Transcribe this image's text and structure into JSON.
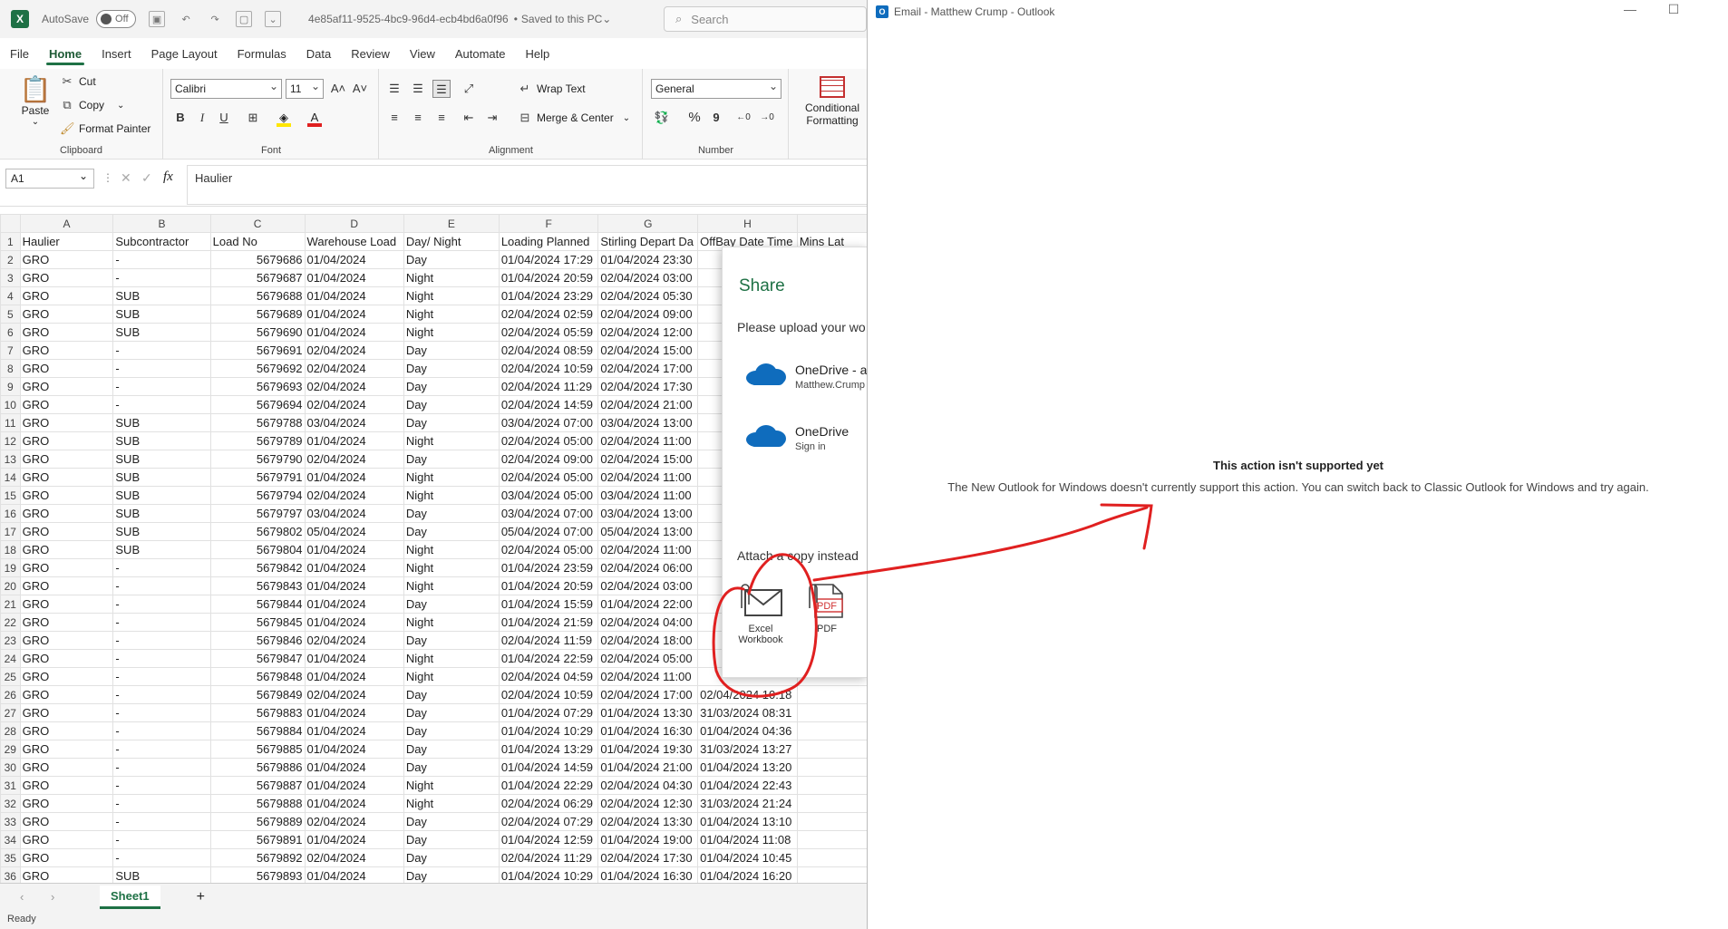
{
  "excel": {
    "title": {
      "autosave_label": "AutoSave",
      "autosave_state": "Off",
      "doc_name": "4e85af11-9525-4bc9-96d4-ecb4bd6a0f96",
      "doc_status": "Saved to this PC",
      "search_placeholder": "Search",
      "logo": "X"
    },
    "menu": [
      "File",
      "Home",
      "Insert",
      "Page Layout",
      "Formulas",
      "Data",
      "Review",
      "View",
      "Automate",
      "Help"
    ],
    "ribbon": {
      "clipboard": {
        "paste": "Paste",
        "cut": "Cut",
        "copy": "Copy",
        "format_painter": "Format Painter",
        "label": "Clipboard"
      },
      "font": {
        "name": "Calibri",
        "size": "11",
        "label": "Font",
        "bold": "B",
        "italic": "I",
        "underline": "U",
        "grow": "A˄",
        "shrink": "A˅"
      },
      "alignment": {
        "wrap": "Wrap Text",
        "merge": "Merge & Center",
        "label": "Alignment"
      },
      "number": {
        "format": "General",
        "label": "Number",
        "percent": "%",
        "comma": "9"
      },
      "styles": {
        "cond1": "Conditional",
        "cond2": "Formatting"
      }
    },
    "formula": {
      "namebox": "A1",
      "fx": "fx",
      "value": "Haulier"
    },
    "columns": [
      "A",
      "B",
      "C",
      "D",
      "E",
      "F",
      "G",
      "H",
      ""
    ],
    "headers": [
      "Haulier",
      "Subcontractor",
      "Load No",
      "Warehouse Load",
      "Day/ Night",
      "Loading Planned",
      "Stirling Depart Da",
      "OffBay Date Time",
      "Mins Lat"
    ],
    "rows": [
      [
        "GRO",
        "-",
        "5679686",
        "01/04/2024",
        "Day",
        "01/04/2024 17:29",
        "01/04/2024 23:30",
        "",
        ""
      ],
      [
        "GRO",
        "-",
        "5679687",
        "01/04/2024",
        "Night",
        "01/04/2024 20:59",
        "02/04/2024 03:00",
        "",
        ""
      ],
      [
        "GRO",
        "SUB",
        "5679688",
        "01/04/2024",
        "Night",
        "01/04/2024 23:29",
        "02/04/2024 05:30",
        "",
        ""
      ],
      [
        "GRO",
        "SUB",
        "5679689",
        "01/04/2024",
        "Night",
        "02/04/2024 02:59",
        "02/04/2024 09:00",
        "",
        ""
      ],
      [
        "GRO",
        "SUB",
        "5679690",
        "01/04/2024",
        "Night",
        "02/04/2024 05:59",
        "02/04/2024 12:00",
        "",
        ""
      ],
      [
        "GRO",
        "-",
        "5679691",
        "02/04/2024",
        "Day",
        "02/04/2024 08:59",
        "02/04/2024 15:00",
        "",
        ""
      ],
      [
        "GRO",
        "-",
        "5679692",
        "02/04/2024",
        "Day",
        "02/04/2024 10:59",
        "02/04/2024 17:00",
        "",
        ""
      ],
      [
        "GRO",
        "-",
        "5679693",
        "02/04/2024",
        "Day",
        "02/04/2024 11:29",
        "02/04/2024 17:30",
        "",
        ""
      ],
      [
        "GRO",
        "-",
        "5679694",
        "02/04/2024",
        "Day",
        "02/04/2024 14:59",
        "02/04/2024 21:00",
        "",
        ""
      ],
      [
        "GRO",
        "SUB",
        "5679788",
        "03/04/2024",
        "Day",
        "03/04/2024 07:00",
        "03/04/2024 13:00",
        "",
        ""
      ],
      [
        "GRO",
        "SUB",
        "5679789",
        "01/04/2024",
        "Night",
        "02/04/2024 05:00",
        "02/04/2024 11:00",
        "",
        ""
      ],
      [
        "GRO",
        "SUB",
        "5679790",
        "02/04/2024",
        "Day",
        "02/04/2024 09:00",
        "02/04/2024 15:00",
        "",
        ""
      ],
      [
        "GRO",
        "SUB",
        "5679791",
        "01/04/2024",
        "Night",
        "02/04/2024 05:00",
        "02/04/2024 11:00",
        "",
        ""
      ],
      [
        "GRO",
        "SUB",
        "5679794",
        "02/04/2024",
        "Night",
        "03/04/2024 05:00",
        "03/04/2024 11:00",
        "",
        ""
      ],
      [
        "GRO",
        "SUB",
        "5679797",
        "03/04/2024",
        "Day",
        "03/04/2024 07:00",
        "03/04/2024 13:00",
        "",
        ""
      ],
      [
        "GRO",
        "SUB",
        "5679802",
        "05/04/2024",
        "Day",
        "05/04/2024 07:00",
        "05/04/2024 13:00",
        "",
        ""
      ],
      [
        "GRO",
        "SUB",
        "5679804",
        "01/04/2024",
        "Night",
        "02/04/2024 05:00",
        "02/04/2024 11:00",
        "",
        ""
      ],
      [
        "GRO",
        "-",
        "5679842",
        "01/04/2024",
        "Night",
        "01/04/2024 23:59",
        "02/04/2024 06:00",
        "",
        ""
      ],
      [
        "GRO",
        "-",
        "5679843",
        "01/04/2024",
        "Night",
        "01/04/2024 20:59",
        "02/04/2024 03:00",
        "",
        ""
      ],
      [
        "GRO",
        "-",
        "5679844",
        "01/04/2024",
        "Day",
        "01/04/2024 15:59",
        "01/04/2024 22:00",
        "",
        ""
      ],
      [
        "GRO",
        "-",
        "5679845",
        "01/04/2024",
        "Night",
        "01/04/2024 21:59",
        "02/04/2024 04:00",
        "",
        ""
      ],
      [
        "GRO",
        "-",
        "5679846",
        "02/04/2024",
        "Day",
        "02/04/2024 11:59",
        "02/04/2024 18:00",
        "",
        ""
      ],
      [
        "GRO",
        "-",
        "5679847",
        "01/04/2024",
        "Night",
        "01/04/2024 22:59",
        "02/04/2024 05:00",
        "",
        ""
      ],
      [
        "GRO",
        "-",
        "5679848",
        "01/04/2024",
        "Night",
        "02/04/2024 04:59",
        "02/04/2024 11:00",
        "",
        ""
      ],
      [
        "GRO",
        "-",
        "5679849",
        "02/04/2024",
        "Day",
        "02/04/2024 10:59",
        "02/04/2024 17:00",
        "02/04/2024 10:18",
        ""
      ],
      [
        "GRO",
        "-",
        "5679883",
        "01/04/2024",
        "Day",
        "01/04/2024 07:29",
        "01/04/2024 13:30",
        "31/03/2024 08:31",
        ""
      ],
      [
        "GRO",
        "-",
        "5679884",
        "01/04/2024",
        "Day",
        "01/04/2024 10:29",
        "01/04/2024 16:30",
        "01/04/2024 04:36",
        ""
      ],
      [
        "GRO",
        "-",
        "5679885",
        "01/04/2024",
        "Day",
        "01/04/2024 13:29",
        "01/04/2024 19:30",
        "31/03/2024 13:27",
        ""
      ],
      [
        "GRO",
        "-",
        "5679886",
        "01/04/2024",
        "Day",
        "01/04/2024 14:59",
        "01/04/2024 21:00",
        "01/04/2024 13:20",
        ""
      ],
      [
        "GRO",
        "-",
        "5679887",
        "01/04/2024",
        "Night",
        "01/04/2024 22:29",
        "02/04/2024 04:30",
        "01/04/2024 22:43",
        ""
      ],
      [
        "GRO",
        "-",
        "5679888",
        "01/04/2024",
        "Night",
        "02/04/2024 06:29",
        "02/04/2024 12:30",
        "31/03/2024 21:24",
        ""
      ],
      [
        "GRO",
        "-",
        "5679889",
        "02/04/2024",
        "Day",
        "02/04/2024 07:29",
        "02/04/2024 13:30",
        "01/04/2024 13:10",
        ""
      ],
      [
        "GRO",
        "-",
        "5679891",
        "01/04/2024",
        "Day",
        "01/04/2024 12:59",
        "01/04/2024 19:00",
        "01/04/2024 11:08",
        ""
      ],
      [
        "GRO",
        "-",
        "5679892",
        "02/04/2024",
        "Day",
        "02/04/2024 11:29",
        "02/04/2024 17:30",
        "01/04/2024 10:45",
        ""
      ],
      [
        "GRO",
        "SUB",
        "5679893",
        "01/04/2024",
        "Day",
        "01/04/2024 10:29",
        "01/04/2024 16:30",
        "01/04/2024 16:20",
        ""
      ]
    ],
    "sheet_tab": "Sheet1",
    "add_sheet": "+",
    "status": "Ready",
    "share": {
      "title": "Share",
      "subtitle": "Please upload your wo",
      "od1_name": "OneDrive - a",
      "od1_sub": "Matthew.Crump",
      "od2_name": "OneDrive",
      "od2_sub": "Sign in",
      "attach_label": "Attach a copy instead",
      "excel_wb_1": "Excel",
      "excel_wb_2": "Workbook",
      "pdf": "PDF",
      "pdf_badge": "PDF"
    }
  },
  "outlook": {
    "window_title": "Email - Matthew Crump - Outlook",
    "logo": "O",
    "msg_title": "This action isn't supported yet",
    "msg_body": "The New Outlook for Windows doesn't currently support this action. You can switch back to Classic Outlook for Windows and try again."
  },
  "annotation_color": "#e02020"
}
